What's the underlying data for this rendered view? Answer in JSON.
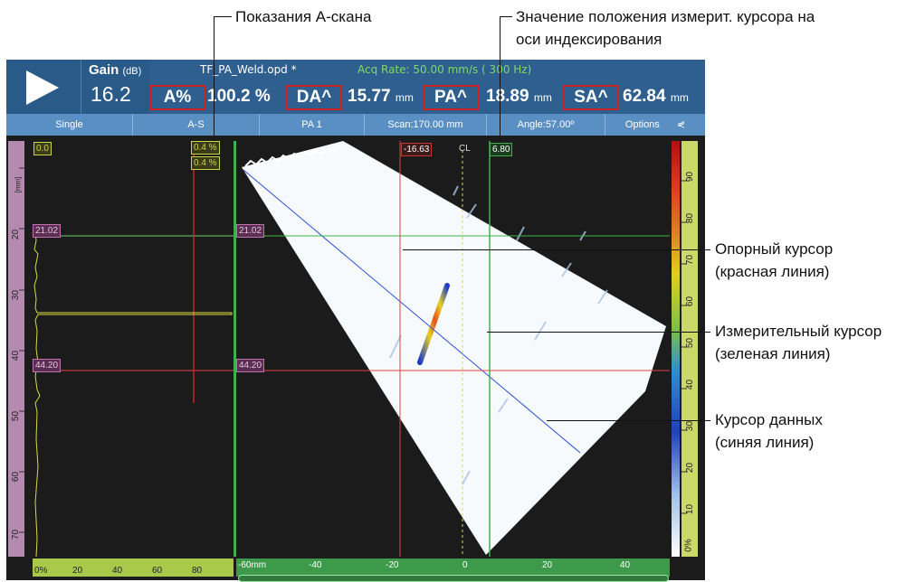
{
  "callouts": {
    "ascan_readings": "Показания А-скана",
    "meas_index_line1": "Значение положения измерит. курсора на",
    "meas_index_line2": "оси индексирования",
    "ref_cursor_1": "Опорный курсор",
    "ref_cursor_2": "(красная линия)",
    "meas_cursor_1": "Измерительный курсор",
    "meas_cursor_2": "(зеленая линия)",
    "data_cursor_1": "Курсор данных",
    "data_cursor_2": "(синяя линия)"
  },
  "header": {
    "gain_label": "Gain",
    "gain_unit": "(dB)",
    "gain_value": "16.2",
    "filename": "TF_PA_Weld.opd *",
    "acq_rate": "Acq Rate: 50.00 mm/s ( 300 Hz)",
    "readings": [
      {
        "name": "A%",
        "value": "100.2",
        "unit": "%"
      },
      {
        "name": "DA^",
        "value": "15.77",
        "unit": "mm"
      },
      {
        "name": "PA^",
        "value": "18.89",
        "unit": "mm"
      },
      {
        "name": "SA^",
        "value": "62.84",
        "unit": "mm"
      }
    ]
  },
  "tabs": [
    {
      "label": "Single"
    },
    {
      "label": "A-S"
    },
    {
      "label": "PA 1"
    },
    {
      "label": "Scan:170.00 mm"
    },
    {
      "label": "Angle:57.00º"
    },
    {
      "label": "Options"
    }
  ],
  "ascan": {
    "top_left": "0.0",
    "gate_a": "0.4 %",
    "gate_b": "0.4 %",
    "ref_depth": "21.02",
    "meas_depth": "44.20"
  },
  "sscan": {
    "ref_depth": "21.02",
    "meas_depth": "44.20",
    "ref_index": "-16.63",
    "meas_index": "6.80",
    "cl_label": "CL"
  },
  "left_ruler": {
    "unit": "[mm]",
    "ticks": [
      "20",
      "30",
      "40",
      "50",
      "60",
      "70"
    ]
  },
  "right_ruler": {
    "ticks": [
      "90",
      "80",
      "70",
      "60",
      "50",
      "40",
      "30",
      "20",
      "10",
      "0%"
    ]
  },
  "bottom_ruler_a": {
    "ticks": [
      "0%",
      "20",
      "40",
      "60",
      "80"
    ]
  },
  "bottom_ruler_s": {
    "ticks": [
      "-60mm",
      "-40",
      "-20",
      "0",
      "20",
      "40"
    ]
  },
  "colors": {
    "reference_cursor": "#e64040",
    "measurement_cursor": "#3cb34a",
    "data_cursor": "#2b4fd6"
  }
}
